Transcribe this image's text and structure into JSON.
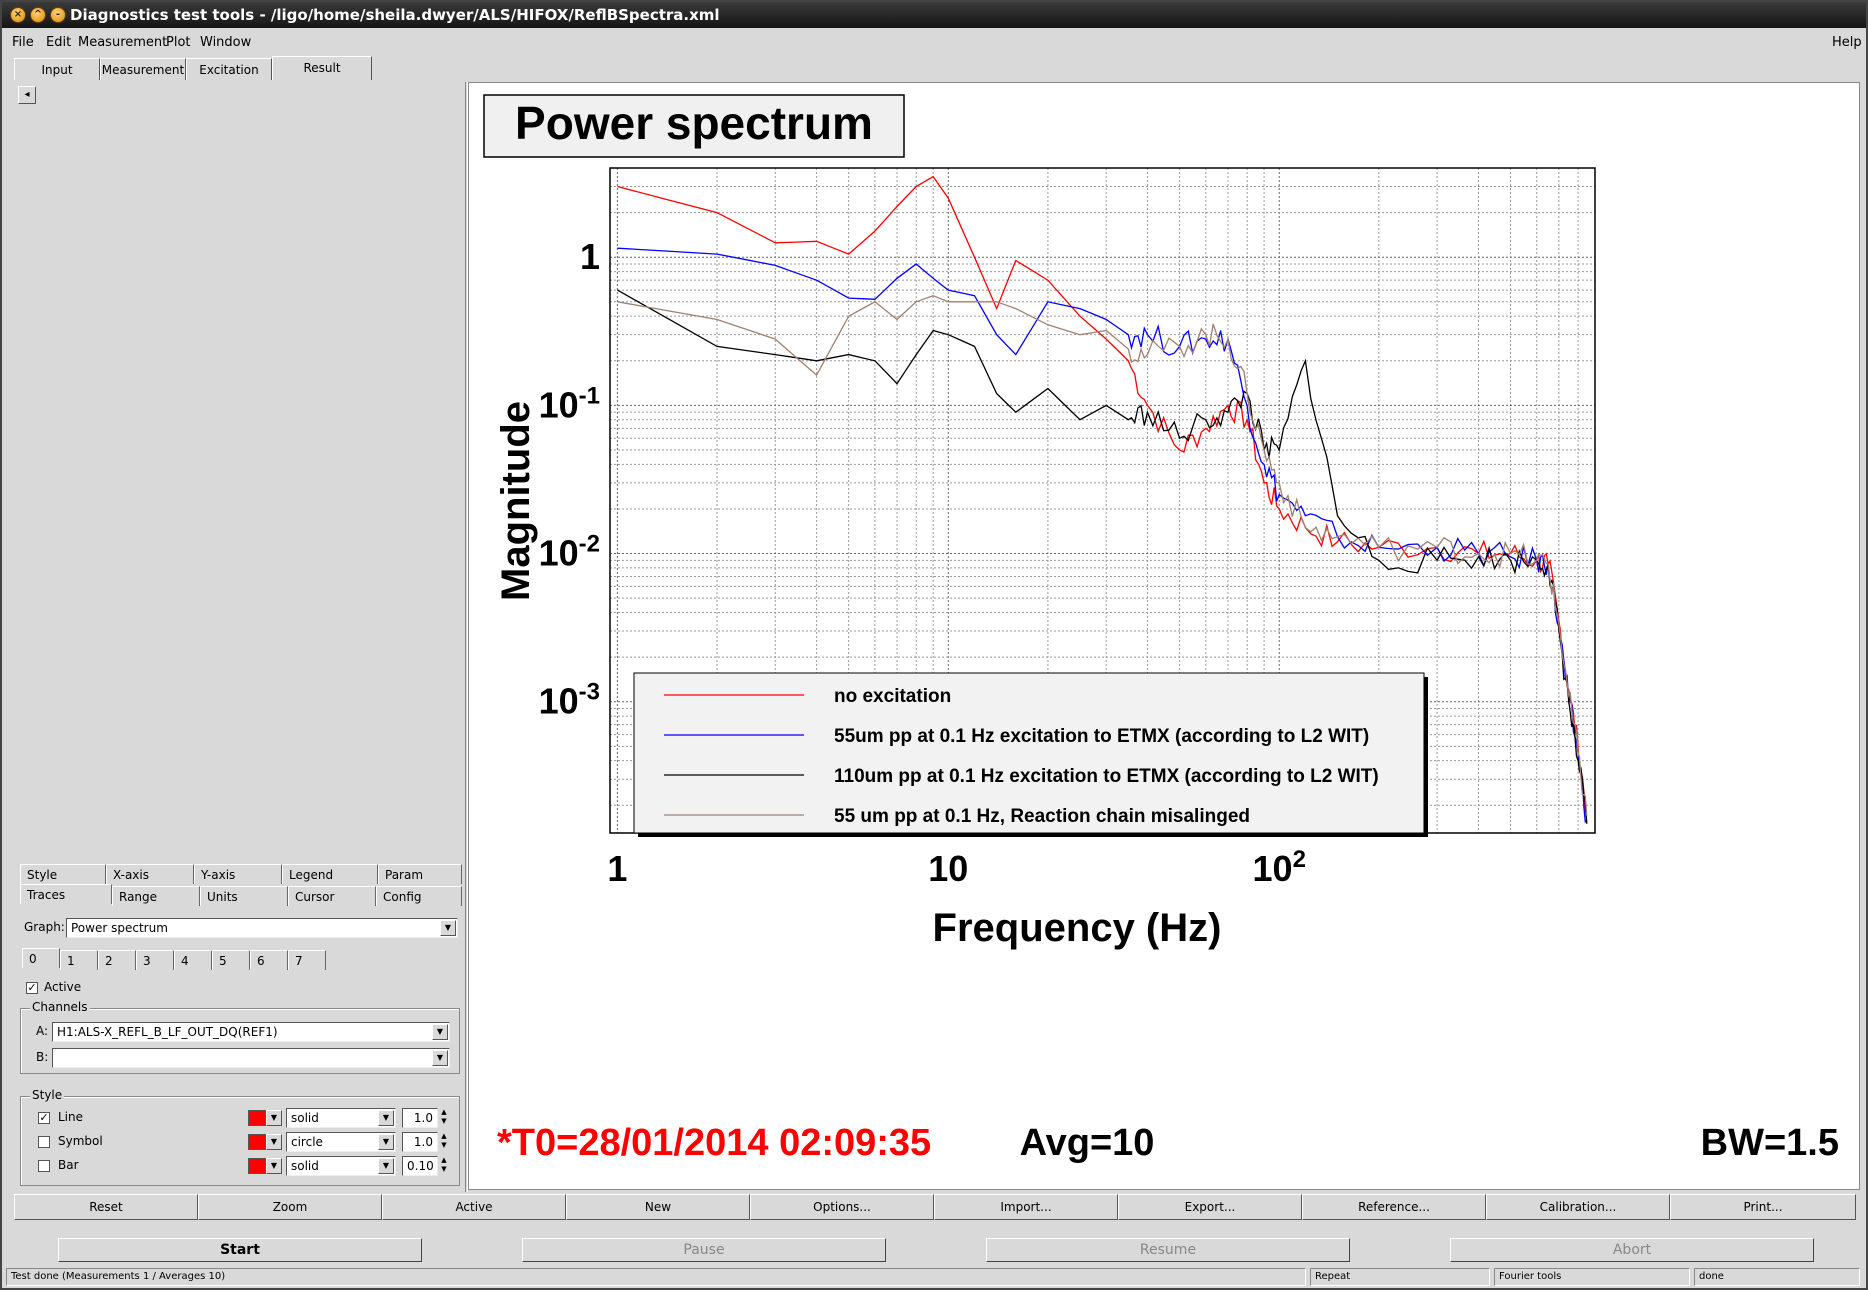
{
  "window": {
    "title": "Diagnostics test tools - /ligo/home/sheila.dwyer/ALS/HIFOX/ReflBSpectra.xml"
  },
  "menu": {
    "file": "File",
    "edit": "Edit",
    "measurement": "Measurement",
    "plot": "Plot",
    "window": "Window",
    "help": "Help"
  },
  "tabs": [
    "Input",
    "Measurement",
    "Excitation",
    "Result"
  ],
  "active_tab": "Result",
  "options_tabs": {
    "row1": [
      "Style",
      "X-axis",
      "Y-axis",
      "Legend",
      "Param"
    ],
    "row2": [
      "Traces",
      "Range",
      "Units",
      "Cursor",
      "Config"
    ]
  },
  "graph": {
    "label": "Graph:",
    "value": "Power spectrum"
  },
  "trace_tabs": [
    "0",
    "1",
    "2",
    "3",
    "4",
    "5",
    "6",
    "7"
  ],
  "active": {
    "label": "Active",
    "checked": true
  },
  "channels": {
    "group_label": "Channels",
    "a_label": "A:",
    "a_value": "H1:ALS-X_REFL_B_LF_OUT_DQ(REF1)",
    "b_label": "B:",
    "b_value": ""
  },
  "style": {
    "group_label": "Style",
    "line": {
      "label": "Line",
      "checked": true,
      "color": "#ff0000",
      "style": "solid",
      "width": "1.0"
    },
    "symbol": {
      "label": "Symbol",
      "checked": false,
      "color": "#ff0000",
      "style": "circle",
      "width": "1.0"
    },
    "bar": {
      "label": "Bar",
      "checked": false,
      "color": "#ff0000",
      "style": "solid",
      "width": "0.10"
    }
  },
  "buttons": [
    "Reset",
    "Zoom",
    "Active",
    "New",
    "Options...",
    "Import...",
    "Export...",
    "Reference...",
    "Calibration...",
    "Print..."
  ],
  "run_buttons": {
    "start": "Start",
    "pause": "Pause",
    "resume": "Resume",
    "abort": "Abort"
  },
  "status": {
    "message": "Test done (Measurements 1 / Averages 10)",
    "repeat": "Repeat",
    "tools": "Fourier tools",
    "state": "done"
  },
  "plot": {
    "title": "Power spectrum",
    "footer_t0": "*T0=28/01/2014 02:09:35",
    "footer_avg": "Avg=10",
    "footer_bw": "BW=1.5"
  },
  "chart_data": {
    "type": "line",
    "title": "Power spectrum",
    "xlabel": "Frequency (Hz)",
    "ylabel": "Magnitude",
    "xscale": "log",
    "yscale": "log",
    "xlim": [
      0.95,
      900
    ],
    "ylim": [
      0.00013,
      4
    ],
    "xticklabels": [
      "1",
      "10",
      "10^2"
    ],
    "yticklabels": [
      "1",
      "10^-1",
      "10^-2",
      "10^-3"
    ],
    "grid": true,
    "legend": "bottom-left",
    "series": [
      {
        "name": "no excitation",
        "color": "#ff0000",
        "x": [
          1,
          2,
          3,
          4,
          5,
          6,
          7,
          8,
          9,
          10,
          12,
          14,
          16,
          20,
          25,
          30,
          35,
          40,
          50,
          60,
          70,
          80,
          90,
          100,
          120,
          150,
          200,
          300,
          400,
          500,
          600,
          650,
          700,
          750,
          800,
          850
        ],
        "y": [
          3.0,
          2.0,
          1.25,
          1.28,
          1.05,
          1.5,
          2.2,
          3.0,
          3.5,
          2.5,
          1.0,
          0.45,
          0.95,
          0.7,
          0.4,
          0.28,
          0.2,
          0.1,
          0.05,
          0.07,
          0.1,
          0.08,
          0.03,
          0.02,
          0.015,
          0.012,
          0.011,
          0.011,
          0.01,
          0.01,
          0.009,
          0.0085,
          0.0035,
          0.0012,
          0.0005,
          0.00018
        ]
      },
      {
        "name": "55um pp at 0.1 Hz excitation to ETMX (according to L2 WIT)",
        "color": "#0000ff",
        "x": [
          1,
          2,
          3,
          4,
          5,
          6,
          7,
          8,
          9,
          10,
          12,
          14,
          16,
          20,
          25,
          30,
          35,
          40,
          50,
          60,
          70,
          80,
          90,
          100,
          120,
          150,
          200,
          300,
          400,
          500,
          600,
          650,
          700,
          750,
          800,
          850
        ],
        "y": [
          1.15,
          1.05,
          0.88,
          0.7,
          0.53,
          0.52,
          0.72,
          0.9,
          0.72,
          0.6,
          0.55,
          0.3,
          0.22,
          0.5,
          0.45,
          0.38,
          0.3,
          0.3,
          0.25,
          0.28,
          0.28,
          0.1,
          0.04,
          0.025,
          0.018,
          0.013,
          0.011,
          0.011,
          0.01,
          0.0095,
          0.009,
          0.0085,
          0.0032,
          0.001,
          0.00045,
          0.00016
        ]
      },
      {
        "name": "110um pp at 0.1 Hz excitation to ETMX (according to L2 WIT)",
        "color": "#000000",
        "x": [
          1,
          2,
          3,
          4,
          5,
          6,
          7,
          8,
          9,
          10,
          12,
          14,
          16,
          20,
          25,
          30,
          35,
          40,
          50,
          60,
          70,
          80,
          90,
          100,
          120,
          150,
          200,
          300,
          400,
          500,
          600,
          650,
          700,
          750,
          800,
          850
        ],
        "y": [
          0.6,
          0.25,
          0.22,
          0.2,
          0.22,
          0.2,
          0.14,
          0.22,
          0.32,
          0.3,
          0.25,
          0.12,
          0.09,
          0.13,
          0.08,
          0.1,
          0.08,
          0.09,
          0.06,
          0.08,
          0.09,
          0.12,
          0.05,
          0.05,
          0.2,
          0.018,
          0.009,
          0.009,
          0.0095,
          0.009,
          0.009,
          0.0085,
          0.003,
          0.001,
          0.0004,
          0.00015
        ]
      },
      {
        "name": "55 um pp at 0.1 Hz, Reaction chain misalinged",
        "color": "#a08070",
        "x": [
          1,
          2,
          3,
          4,
          5,
          6,
          7,
          8,
          9,
          10,
          12,
          14,
          16,
          20,
          25,
          30,
          35,
          40,
          50,
          60,
          70,
          80,
          90,
          100,
          120,
          150,
          200,
          300,
          400,
          500,
          600,
          650,
          700,
          750,
          800,
          850
        ],
        "y": [
          0.5,
          0.38,
          0.28,
          0.16,
          0.4,
          0.5,
          0.38,
          0.5,
          0.55,
          0.5,
          0.5,
          0.5,
          0.45,
          0.35,
          0.3,
          0.32,
          0.24,
          0.22,
          0.25,
          0.3,
          0.28,
          0.12,
          0.05,
          0.03,
          0.015,
          0.013,
          0.011,
          0.011,
          0.01,
          0.01,
          0.009,
          0.0085,
          0.0033,
          0.0011,
          0.00045,
          0.00017
        ]
      }
    ]
  }
}
